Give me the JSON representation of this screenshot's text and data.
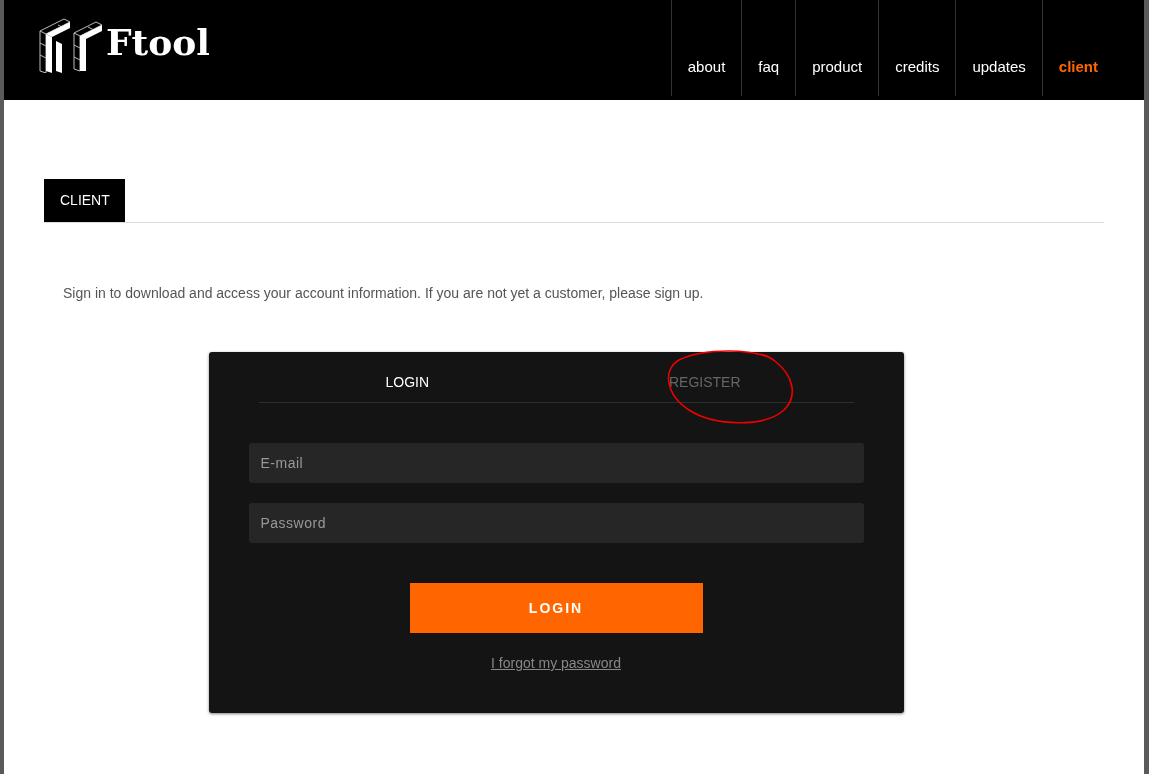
{
  "header": {
    "logo_text": "Ftool",
    "nav": [
      {
        "label": "about",
        "selected": false
      },
      {
        "label": "faq",
        "selected": false
      },
      {
        "label": "product",
        "selected": false
      },
      {
        "label": "credits",
        "selected": false
      },
      {
        "label": "updates",
        "selected": false
      },
      {
        "label": "client",
        "selected": true
      }
    ]
  },
  "section_tab": "CLIENT",
  "intro": "Sign in to download and access your account information. If you are not yet a customer, please sign up.",
  "card": {
    "tabs": [
      {
        "label": "LOGIN",
        "selected": true
      },
      {
        "label": "REGISTER",
        "selected": false
      }
    ],
    "fields": [
      {
        "placeholder": "E-mail"
      },
      {
        "placeholder": "Password"
      }
    ],
    "button": "LOGIN",
    "link": "I forgot my password"
  }
}
